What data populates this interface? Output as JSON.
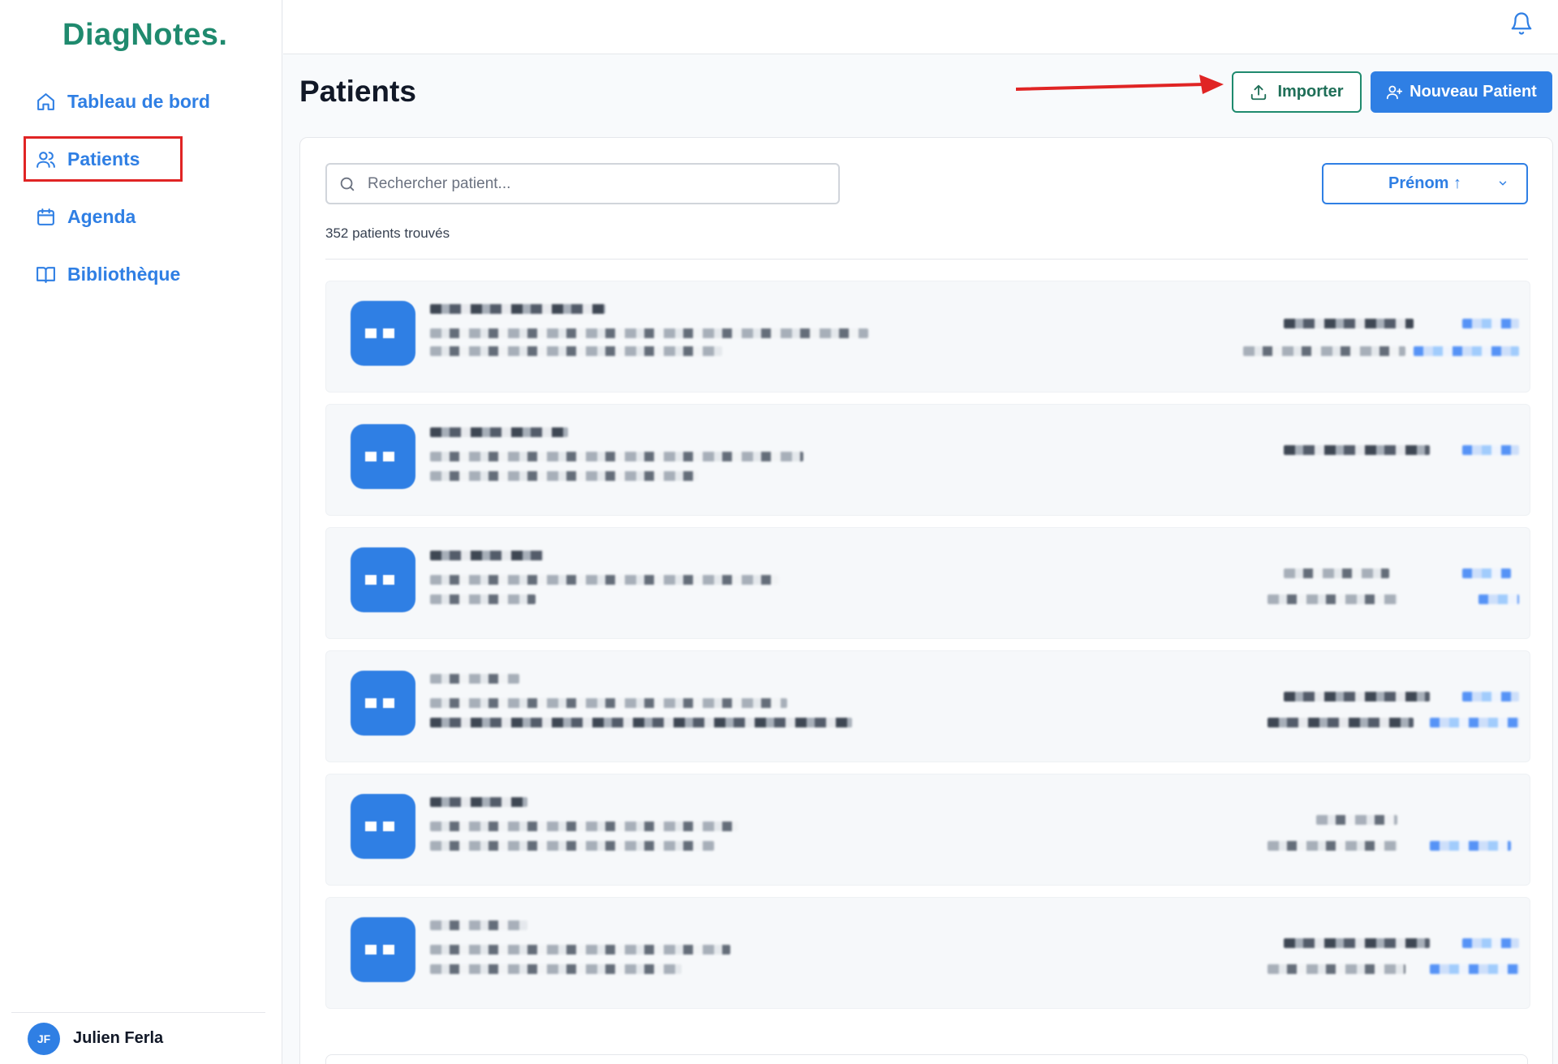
{
  "app": {
    "logo": "DiagNotes."
  },
  "sidebar": {
    "items": [
      {
        "label": "Tableau de bord",
        "icon": "home-icon"
      },
      {
        "label": "Patients",
        "icon": "users-icon"
      },
      {
        "label": "Agenda",
        "icon": "calendar-icon"
      },
      {
        "label": "Bibliothèque",
        "icon": "book-icon"
      }
    ],
    "user": {
      "initials": "JF",
      "name": "Julien Ferla"
    }
  },
  "header": {
    "title": "Patients",
    "import_label": "Importer",
    "new_patient_label": "Nouveau Patient"
  },
  "list": {
    "search_placeholder": "Rechercher patient...",
    "sort_label": "Prénom ↑",
    "count_text": "352 patients trouvés",
    "rows_visible": 6
  },
  "colors": {
    "accent": "#2f7fe4",
    "brand": "#1f8a6e",
    "annotation": "#e02424"
  }
}
